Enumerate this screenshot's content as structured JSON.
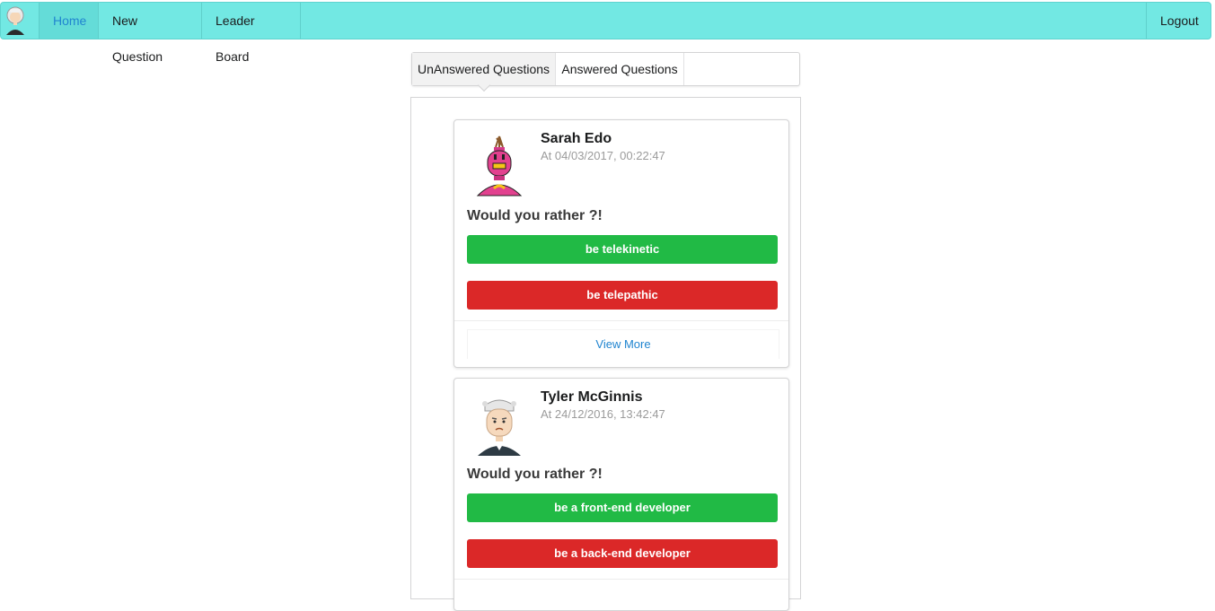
{
  "nav": {
    "avatar_icon": "user-avatar-icon",
    "items": [
      {
        "label": "Home",
        "active": true
      },
      {
        "label": "New Question",
        "active": false
      },
      {
        "label": "Leader Board",
        "active": false
      }
    ],
    "logout_label": "Logout"
  },
  "tabs": [
    {
      "label": "UnAnswered Questions",
      "active": true
    },
    {
      "label": "Answered Questions",
      "active": false
    }
  ],
  "questions": [
    {
      "author": "Sarah Edo",
      "timestamp": "At 04/03/2017, 00:22:47",
      "avatar_icon": "robot-avatar-icon",
      "prompt": "Would you rather ?!",
      "option_one": "be telekinetic",
      "option_two": "be telepathic",
      "view_more": "View More"
    },
    {
      "author": "Tyler McGinnis",
      "timestamp": "At 24/12/2016, 13:42:47",
      "avatar_icon": "old-man-avatar-icon",
      "prompt": "Would you rather ?!",
      "option_one": "be a front-end developer",
      "option_two": "be a back-end developer",
      "view_more": "View More"
    }
  ],
  "colors": {
    "navbar": "#72e8e3",
    "active_link": "#2185d0",
    "option_one": "#21ba45",
    "option_two": "#db2828"
  }
}
